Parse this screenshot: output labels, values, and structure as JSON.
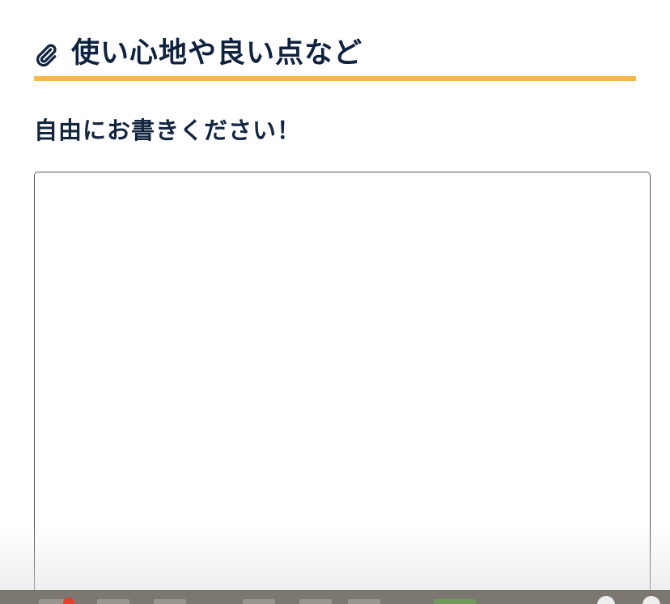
{
  "section": {
    "icon": "paperclip-icon",
    "title": "使い心地や良い点など",
    "accent_color": "#f6b84e",
    "title_color": "#0f2340"
  },
  "prompt": {
    "text": "自由にお書きください！"
  },
  "feedback": {
    "value": "",
    "placeholder": ""
  }
}
